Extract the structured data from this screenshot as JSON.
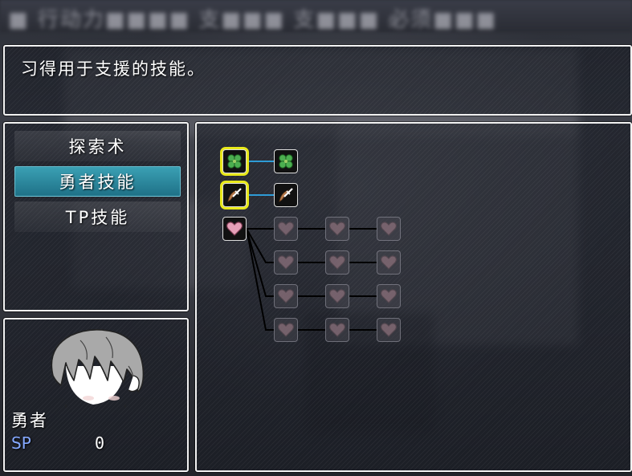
{
  "header": {
    "blurred_title": "■ 行动力■■■■ 支■■■ 支■■■ 必须■■■"
  },
  "help": {
    "description": "习得用于支援的技能。"
  },
  "categories": [
    {
      "label": "探索术",
      "selected": false
    },
    {
      "label": "勇者技能",
      "selected": true
    },
    {
      "label": "TP技能",
      "selected": false
    }
  ],
  "actor": {
    "name": "勇者",
    "sp_label": "SP",
    "sp_value": "0"
  },
  "colors": {
    "selection_highlight": "#e8e81a",
    "category_selected": "#2a8aa0",
    "sp_label": "#84a8ff",
    "connector_learned": "#2e9bd6",
    "connector_locked": "#000000",
    "clover": "#4caf50",
    "heart": "#e6a0b8"
  },
  "skill_tree": {
    "rows": [
      {
        "icon": "clover-icon",
        "nodes": [
          "learned-selected",
          "learned"
        ]
      },
      {
        "icon": "sword-icon",
        "nodes": [
          "learned-selected",
          "learned"
        ]
      },
      {
        "icon": "heart-icon",
        "nodes": [
          "learned",
          "locked",
          "locked",
          "locked"
        ]
      }
    ],
    "heart_branches": [
      [
        "locked",
        "locked",
        "locked"
      ],
      [
        "locked",
        "locked",
        "locked"
      ],
      [
        "locked",
        "locked",
        "locked"
      ]
    ]
  }
}
